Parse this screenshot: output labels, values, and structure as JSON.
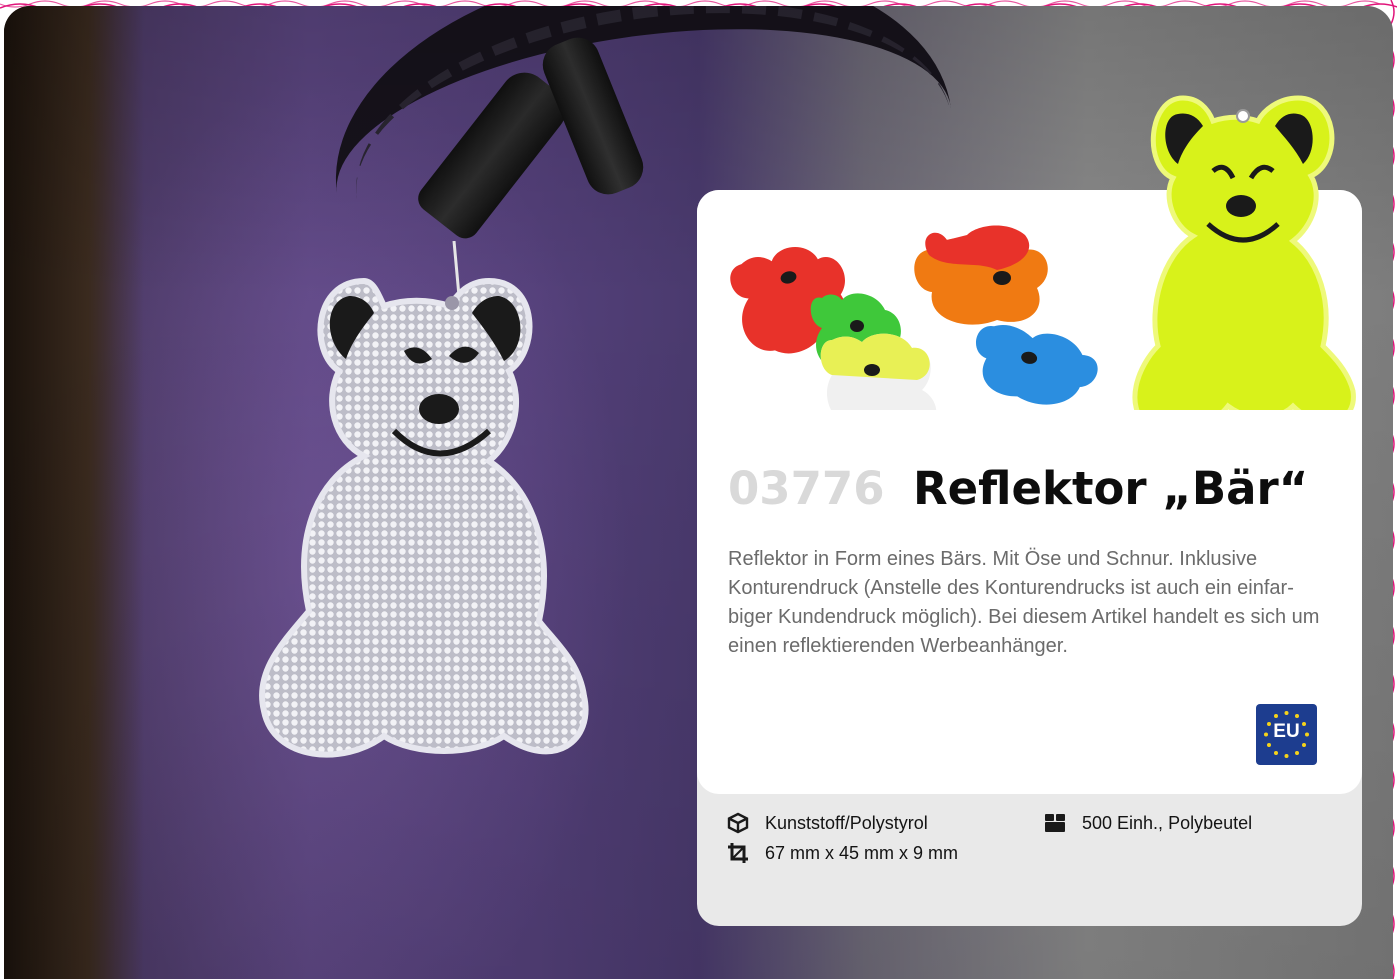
{
  "product": {
    "number": "03776",
    "name": "Reflektor „Bär“",
    "description": "Reflektor in Form eines Bärs. Mit Öse und Schnur. Inklusive Konturendruck (Anstelle des Konturendrucks ist auch ein einfar-biger Kundendruck möglich). Bei diesem Artikel handelt es sich um einen reflektierenden Werbeanhänger."
  },
  "badge": {
    "label": "EU",
    "icon": "eu-flag-icon",
    "color": "#1d3d8f"
  },
  "specs": {
    "material": {
      "icon": "box-icon",
      "value": "Kunststoff/Polystyrol"
    },
    "dimensions": {
      "icon": "crop-icon",
      "value": "67 mm x 45 mm x 9 mm"
    },
    "packaging": {
      "icon": "package-icon",
      "value": "500 Einh., Polybeutel"
    }
  },
  "colors": {
    "accent_pink": "#e0147a",
    "eu_blue": "#1d3d8f",
    "title_number": "#d9d9d9",
    "bear_colors": [
      "#e8322a",
      "#3fc83a",
      "#f07a12",
      "#2b8ee0",
      "#d8f21a",
      "#eeeeee"
    ]
  }
}
